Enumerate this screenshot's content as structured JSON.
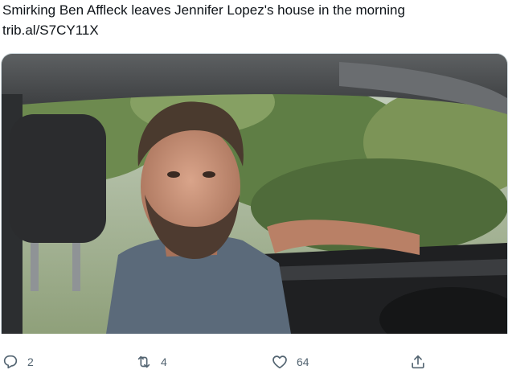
{
  "tweet": {
    "text_line1": "Smirking Ben Affleck leaves Jennifer Lopez's house in the morning",
    "link": "trib.al/S7CY11X"
  },
  "media": {
    "icon": "photo-of-man-in-car"
  },
  "actions": {
    "reply": {
      "icon": "reply-icon",
      "count": "2"
    },
    "retweet": {
      "icon": "retweet-icon",
      "count": "4"
    },
    "like": {
      "icon": "heart-icon",
      "count": "64"
    },
    "share": {
      "icon": "share-icon"
    }
  },
  "colors": {
    "text": "#0f1419",
    "action_gray": "#536471",
    "border": "#cfd9de"
  }
}
